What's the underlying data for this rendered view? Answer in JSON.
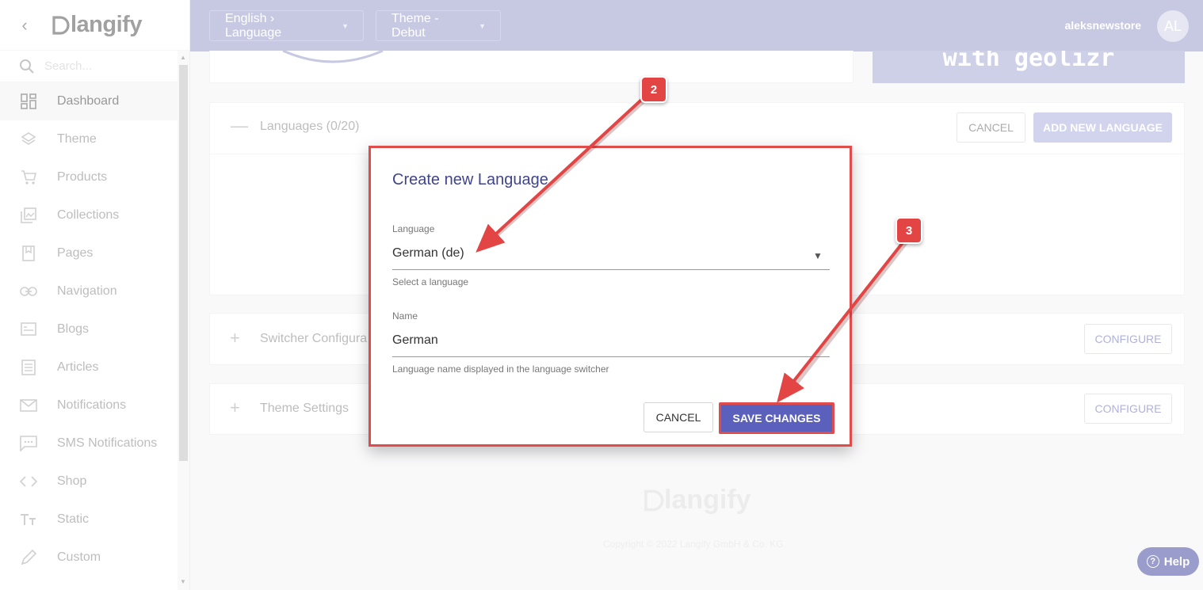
{
  "sidebar": {
    "search_placeholder": "Search...",
    "logo_text": "langify",
    "items": [
      {
        "label": "Dashboard",
        "icon": "dashboard-icon"
      },
      {
        "label": "Theme",
        "icon": "layers-icon"
      },
      {
        "label": "Products",
        "icon": "cart-icon"
      },
      {
        "label": "Collections",
        "icon": "collections-icon"
      },
      {
        "label": "Pages",
        "icon": "pages-icon"
      },
      {
        "label": "Navigation",
        "icon": "link-icon"
      },
      {
        "label": "Blogs",
        "icon": "blogs-icon"
      },
      {
        "label": "Articles",
        "icon": "articles-icon"
      },
      {
        "label": "Notifications",
        "icon": "mail-icon"
      },
      {
        "label": "SMS Notifications",
        "icon": "sms-icon"
      },
      {
        "label": "Shop",
        "icon": "code-icon"
      },
      {
        "label": "Static",
        "icon": "text-icon"
      },
      {
        "label": "Custom",
        "icon": "pencil-icon"
      }
    ]
  },
  "header": {
    "language_selector": "English › Language",
    "theme_selector": "Theme - Debut",
    "username": "aleksnewstore",
    "avatar_initials": "AL"
  },
  "banner": {
    "text": "with geolizr"
  },
  "languages_panel": {
    "title": "Languages (0/20)",
    "cancel_label": "CANCEL",
    "add_label": "ADD NEW LANGUAGE"
  },
  "switcher_panel": {
    "title": "Switcher Configura",
    "configure_label": "CONFIGURE"
  },
  "theme_settings_panel": {
    "title": "Theme Settings",
    "configure_label": "CONFIGURE"
  },
  "modal": {
    "title": "Create new Language",
    "language_label": "Language",
    "language_value": "German (de)",
    "language_hint": "Select a language",
    "name_label": "Name",
    "name_value": "German",
    "name_hint": "Language name displayed in the language switcher",
    "cancel_label": "CANCEL",
    "save_label": "SAVE CHANGES"
  },
  "annotations": {
    "step2": "2",
    "step3": "3",
    "color": "#e34545"
  },
  "footer": {
    "logo_text": "langify",
    "copyright": "Copyright © 2022 Langify GmbH & Co. KG",
    "help_label": "Help"
  },
  "colors": {
    "header": "#9a9dcb",
    "primary": "#5a60bc",
    "annotation": "#e04b4b"
  }
}
